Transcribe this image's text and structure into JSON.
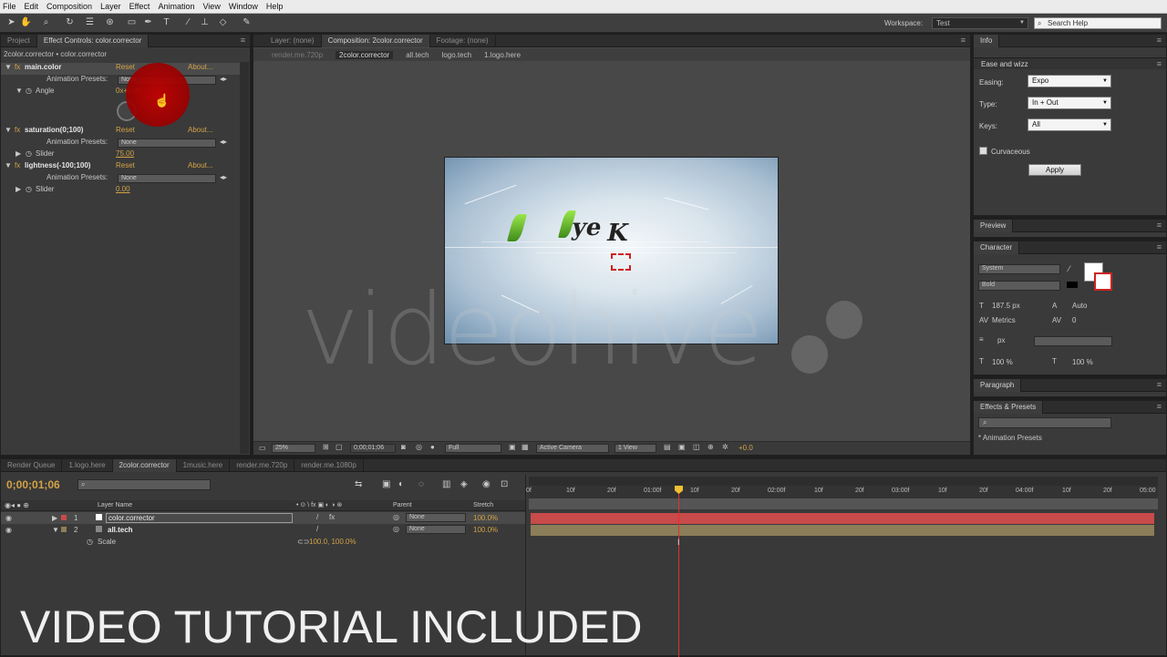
{
  "menu": [
    "File",
    "Edit",
    "Composition",
    "Layer",
    "Effect",
    "Animation",
    "View",
    "Window",
    "Help"
  ],
  "workspace": {
    "label": "Workspace:",
    "value": "Test",
    "search_placeholder": "Search Help"
  },
  "left_panel": {
    "tabs": [
      "Project",
      "Effect Controls: color.corrector"
    ],
    "breadcrumb": "2color.corrector • color.corrector",
    "effects": [
      {
        "name": "main.color",
        "reset": "Reset",
        "about": "About...",
        "presets_label": "Animation Presets:",
        "presets_value": "None",
        "param": "Angle",
        "param_value": "0x+0.0°"
      },
      {
        "name": "saturation(0;100)",
        "reset": "Reset",
        "about": "About...",
        "presets_label": "Animation Presets:",
        "presets_value": "None",
        "param": "Slider",
        "param_value": "75.00"
      },
      {
        "name": "lightness(-100;100)",
        "reset": "Reset",
        "about": "About...",
        "presets_label": "Animation Presets:",
        "presets_value": "None",
        "param": "Slider",
        "param_value": "0.00"
      }
    ]
  },
  "center_panel": {
    "tabs": [
      "Layer: (none)",
      "Composition: 2color.corrector",
      "Footage: (none)"
    ],
    "subtabs": [
      "render.me.720p",
      "2color.corrector",
      "all.tech",
      "logo.tech",
      "1.logo.here"
    ],
    "watermark": "videohive",
    "footer": {
      "zoom": "25%",
      "timecode": "0;00;01;06",
      "resolution": "Full",
      "camera": "Active Camera",
      "view": "1 View",
      "exposure": "+0.0"
    }
  },
  "right_panel": {
    "info_tab": "Info",
    "ease_tab": "Ease and wizz",
    "easing": {
      "label": "Easing:",
      "value": "Expo"
    },
    "type": {
      "label": "Type:",
      "value": "In + Out"
    },
    "keys": {
      "label": "Keys:",
      "value": "All"
    },
    "curvaceous": "Curvaceous",
    "apply": "Apply",
    "preview_tab": "Preview",
    "character_tab": "Character",
    "font": "System",
    "style": "Bold",
    "font_size": "187.5 px",
    "leading": "Auto",
    "kerning": "Metrics",
    "tracking": "0",
    "stroke_unit": "px",
    "vscale": "100 %",
    "hscale": "100 %",
    "paragraph_tab": "Paragraph",
    "effects_tab": "Effects & Presets",
    "presets_item": "* Animation Presets"
  },
  "timeline": {
    "tabs": [
      "Render Queue",
      "1.logo.here",
      "2color.corrector",
      "1music.here",
      "render.me.720p",
      "render.me.1080p"
    ],
    "timecode": "0;00;01;06",
    "headers": {
      "layer_name": "Layer Name",
      "parent": "Parent",
      "stretch": "Stretch"
    },
    "layers": [
      {
        "num": "1",
        "name": "color.corrector",
        "parent": "None",
        "stretch": "100.0%"
      },
      {
        "num": "2",
        "name": "all.tech",
        "parent": "None",
        "stretch": "100.0%"
      }
    ],
    "scale": {
      "label": "Scale",
      "value": "100.0, 100.0%"
    },
    "ruler": [
      "0f",
      "10f",
      "20f",
      "01:00f",
      "10f",
      "20f",
      "02:00f",
      "10f",
      "20f",
      "03:00f",
      "10f",
      "20f",
      "04:00f",
      "10f",
      "20f",
      "05:00"
    ]
  },
  "overlay_text": "VIDEO TUTORIAL INCLUDED",
  "colors": {
    "accent_orange": "#d2a246",
    "layer1_bar": "#c84a4a",
    "layer2_bar": "#8b7e58",
    "cursor_red": "#b00000"
  }
}
